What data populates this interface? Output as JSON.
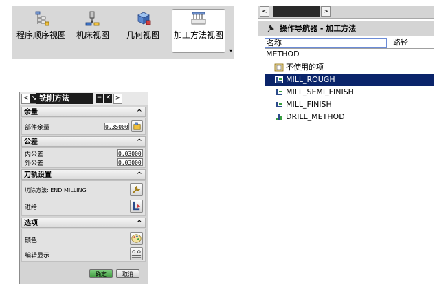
{
  "toolbar": {
    "buttons": [
      {
        "label": "程序顺序视图",
        "icon": "program-order-view-icon"
      },
      {
        "label": "机床视图",
        "icon": "machine-tool-view-icon"
      },
      {
        "label": "几何视图",
        "icon": "geometry-view-icon"
      },
      {
        "label": "加工方法视图",
        "icon": "machining-method-view-icon",
        "active": true
      }
    ],
    "dropdown_arrow": "▾"
  },
  "dialog": {
    "title": "铣削方法",
    "nav_prev": "<",
    "nav_next": ">",
    "title_icon": "↘",
    "minimize": "−",
    "close": "✕",
    "sections": {
      "stock": {
        "header": "余量",
        "part_stock_label": "部件余量",
        "part_stock_value": "0.35000"
      },
      "tolerance": {
        "header": "公差",
        "intol_label": "内公差",
        "intol_value": "0.03000",
        "outtol_label": "外公差",
        "outtol_value": "0.03000"
      },
      "tool_path": {
        "header": "刀轨设置",
        "cut_method_label": "切除方法: END MILLING",
        "feeds_label": "进给"
      },
      "options": {
        "header": "选项",
        "color_label": "颜色",
        "edit_display_label": "编辑显示"
      }
    },
    "ok_label": "确定",
    "cancel_label": "取消"
  },
  "navigator": {
    "title": "操作导航器 - 加工方法",
    "columns": {
      "name": "名称",
      "path": "路径"
    },
    "root": "METHOD",
    "items": [
      {
        "label": "不使用的项",
        "icon": "unused-items-icon"
      },
      {
        "label": "MILL_ROUGH",
        "icon": "mill-method-icon",
        "selected": true
      },
      {
        "label": "MILL_SEMI_FINISH",
        "icon": "mill-method-icon"
      },
      {
        "label": "MILL_FINISH",
        "icon": "mill-method-icon"
      },
      {
        "label": "DRILL_METHOD",
        "icon": "drill-method-icon"
      }
    ],
    "scroll_left": "<",
    "scroll_right": ">"
  },
  "colors": {
    "selection": "#0a246a",
    "title_bar": "#1c1c1c",
    "toolbar_bg": "#d8d8d8"
  }
}
